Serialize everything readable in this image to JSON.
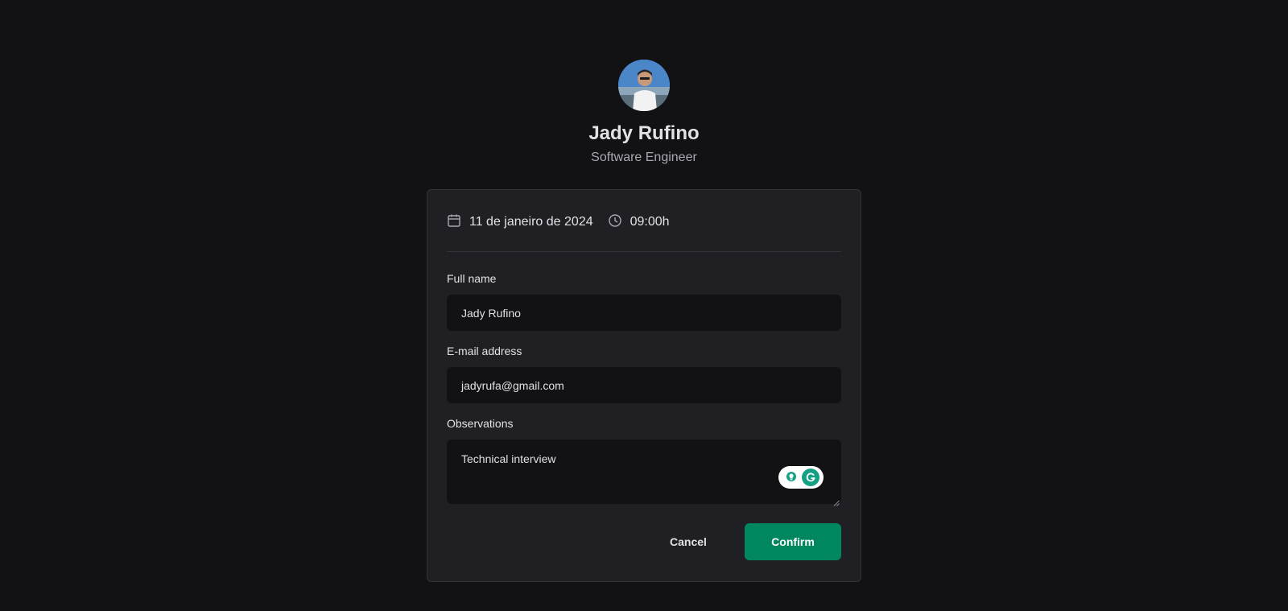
{
  "profile": {
    "name": "Jady Rufino",
    "role": "Software Engineer"
  },
  "schedule": {
    "date": "11 de janeiro de 2024",
    "time": "09:00h"
  },
  "form": {
    "full_name": {
      "label": "Full name",
      "value": "Jady Rufino"
    },
    "email": {
      "label": "E-mail address",
      "value": "jadyrufa@gmail.com"
    },
    "observations": {
      "label": "Observations",
      "value": "Technical interview"
    }
  },
  "actions": {
    "cancel_label": "Cancel",
    "confirm_label": "Confirm"
  },
  "colors": {
    "background": "#121214",
    "card": "#202024",
    "accent": "#00875f",
    "assistant": "#15a085"
  },
  "icons": {
    "date": "calendar-icon",
    "time": "clock-icon",
    "assistant": "grammar-assistant-icon"
  }
}
